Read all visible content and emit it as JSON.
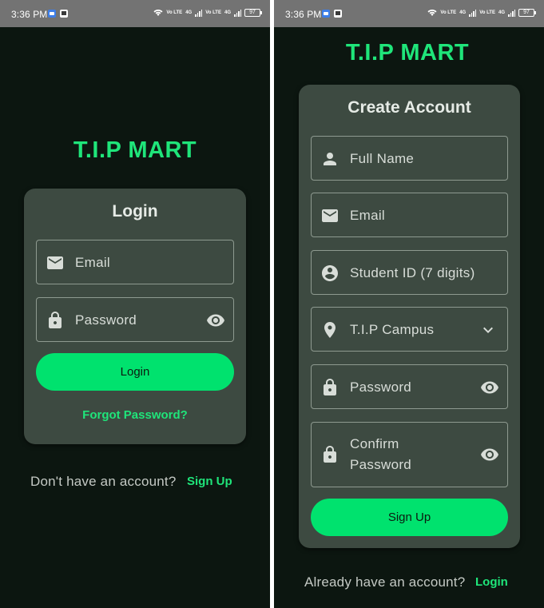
{
  "status_bar": {
    "time": "3:36 PM",
    "battery": "97",
    "network_1": "Vo LTE",
    "network_2": "Vo LTE",
    "signal_1": "4G",
    "signal_2": "4G"
  },
  "login_screen": {
    "brand": "T.I.P MART",
    "title": "Login",
    "fields": {
      "email": {
        "label": "Email",
        "icon": "email-icon"
      },
      "password": {
        "label": "Password",
        "icon": "lock-icon",
        "trailing_icon": "eye-icon"
      }
    },
    "login_button": "Login",
    "forgot_password": "Forgot Password?",
    "no_account_text": "Don't have an account?",
    "sign_up_link": "Sign Up"
  },
  "signup_screen": {
    "brand": "T.I.P MART",
    "title": "Create Account",
    "fields": {
      "full_name": {
        "label": "Full Name",
        "icon": "person-icon"
      },
      "email": {
        "label": "Email",
        "icon": "email-icon"
      },
      "student_id": {
        "label": "Student ID (7 digits)",
        "icon": "account-circle-icon"
      },
      "campus": {
        "label": "T.I.P Campus",
        "icon": "location-pin-icon",
        "trailing_icon": "chevron-down-icon"
      },
      "password": {
        "label": "Password",
        "icon": "lock-icon",
        "trailing_icon": "eye-icon"
      },
      "confirm_password": {
        "label_line1": "Confirm",
        "label_line2": "Password",
        "icon": "lock-icon",
        "trailing_icon": "eye-icon"
      }
    },
    "sign_up_button": "Sign Up",
    "have_account_text": "Already have an account?",
    "login_link": "Login"
  },
  "colors": {
    "background": "#0c1610",
    "card": "#3d4a41",
    "accent": "#00e26e",
    "brand_text": "#1fe57a",
    "status_bar": "#737373"
  }
}
